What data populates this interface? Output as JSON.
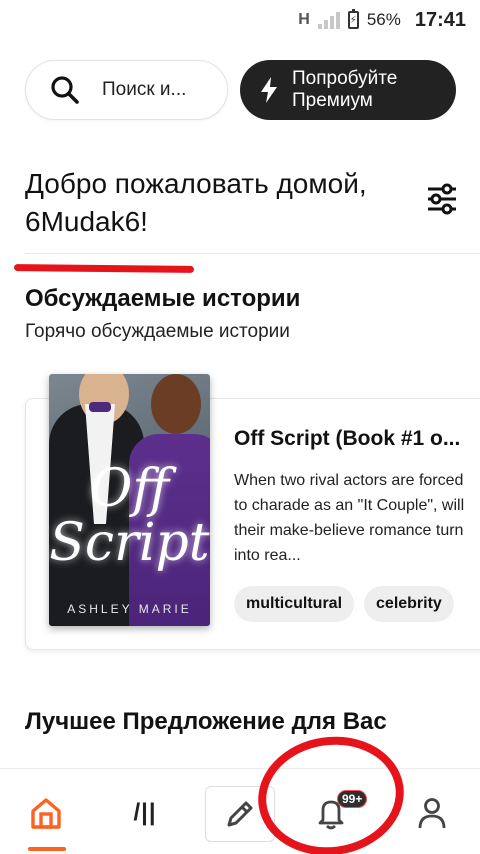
{
  "status_bar": {
    "network": "H",
    "battery": "56%",
    "time": "17:41"
  },
  "top_bar": {
    "search_label": "Поиск и...",
    "premium_label": "Попробуйте\nПремиум"
  },
  "greeting": "Добро пожаловать домой, 6Mudak6!",
  "section": {
    "title": "Обсуждаемые истории",
    "subtitle": "Горячо обсуждаемые истории"
  },
  "story": {
    "title": "Off Script (Book #1 o...",
    "description": "When two rival actors are forced to charade as an \"It Couple\", will their make-believe romance turn into rea...",
    "cover_title": "Off Script",
    "cover_author": "ASHLEY MARIE",
    "tags": [
      "multicultural",
      "celebrity"
    ]
  },
  "offer_title": "Лучшее Предложение для Вас",
  "nav": {
    "library_glyph": "/||",
    "notification_badge": "99+"
  },
  "colors": {
    "accent": "#ff6122",
    "premium_bg": "#222222",
    "annotation_red": "#e5141b"
  }
}
